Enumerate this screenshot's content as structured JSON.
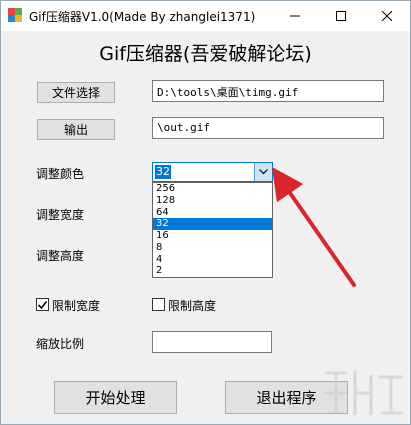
{
  "window": {
    "title": "Gif压缩器V1.0(Made By zhanglei1371)",
    "heading": "Gif压缩器(吾爱破解论坛)"
  },
  "buttons": {
    "file_select": "文件选择",
    "output": "输出",
    "start": "开始处理",
    "exit": "退出程序"
  },
  "fields": {
    "file_path": "D:\\tools\\桌面\\timg.gif",
    "output_path": "\\out.gif",
    "scale_ratio": ""
  },
  "labels": {
    "adjust_color": "调整颜色",
    "adjust_width": "调整宽度",
    "adjust_height": "调整高度",
    "limit_width": "限制宽度",
    "limit_height": "限制高度",
    "scale_ratio": "缩放比例"
  },
  "color_combo": {
    "selected": "32",
    "options": [
      "256",
      "128",
      "64",
      "32",
      "16",
      "8",
      "4",
      "2"
    ]
  },
  "checkboxes": {
    "limit_width_checked": true,
    "limit_height_checked": false
  },
  "colors": {
    "accent": "#0078d7",
    "annotation_arrow": "#d9262c"
  }
}
